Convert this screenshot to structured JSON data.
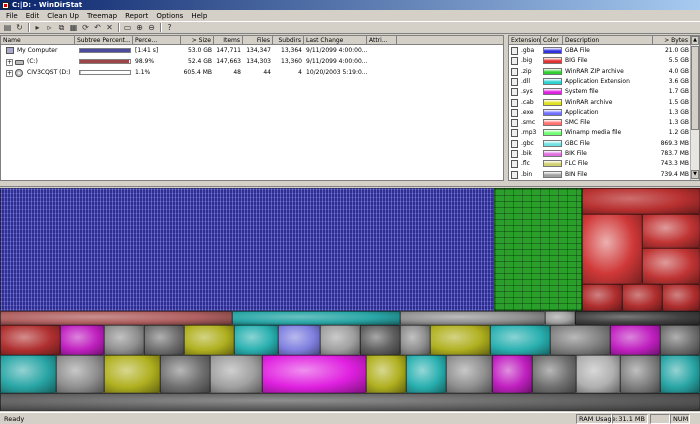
{
  "window": {
    "title": "C:|D: - WinDirStat"
  },
  "menu": [
    "File",
    "Edit",
    "Clean Up",
    "Treemap",
    "Report",
    "Options",
    "Help"
  ],
  "toolbar": [
    "open-folder-icon",
    "refresh-icon",
    "separator",
    "play-icon",
    "step-icon",
    "copy-icon",
    "props-icon",
    "refresh-all-icon",
    "undo-icon",
    "delete-icon",
    "separator",
    "select-icon",
    "zoom-in-icon",
    "zoom-out-icon",
    "separator",
    "help-icon"
  ],
  "dir_columns": [
    "Name",
    "Subtree Percent...",
    "Perce...",
    "> Size",
    "Items",
    "Files",
    "Subdirs",
    "Last Change",
    "Attri..."
  ],
  "dir_rows": [
    {
      "expander": "",
      "icon": "computer-icon",
      "name": "My Computer",
      "bar_pct": 1.0,
      "bar_color": "#4b4ba0",
      "pct": "[1:41 s]",
      "size": "53.0 GB",
      "items": "147,711",
      "files": "134,347",
      "subdirs": "13,364",
      "last_change": "9/11/2099  4:00:00...",
      "attr": ""
    },
    {
      "expander": "+",
      "icon": "drive-icon",
      "name": "(C:)",
      "bar_pct": 0.989,
      "bar_color": "#a04545",
      "pct": "98.9%",
      "size": "52.4 GB",
      "items": "147,663",
      "files": "134,303",
      "subdirs": "13,360",
      "last_change": "9/11/2099  4:00:00...",
      "attr": ""
    },
    {
      "expander": "+",
      "icon": "cd-icon",
      "name": "CIV3CQST (D:)",
      "bar_pct": 0.011,
      "bar_color": "#c0c0c0",
      "pct": "1.1%",
      "size": "605.4 MB",
      "items": "48",
      "files": "44",
      "subdirs": "4",
      "last_change": "10/20/2003  5:19:0...",
      "attr": ""
    }
  ],
  "ext_columns": [
    "Extension",
    "Color",
    "Description",
    "> Bytes"
  ],
  "ext_rows": [
    {
      "ext": ".gba",
      "color": "#3030e0",
      "desc": "GBA File",
      "bytes": "21.0 GB"
    },
    {
      "ext": ".big",
      "color": "#e03030",
      "desc": "BIG File",
      "bytes": "5.5 GB"
    },
    {
      "ext": ".zip",
      "color": "#30d030",
      "desc": "WinRAR ZIP archive",
      "bytes": "4.0 GB"
    },
    {
      "ext": ".dll",
      "color": "#30d0d0",
      "desc": "Application Extension",
      "bytes": "3.6 GB"
    },
    {
      "ext": ".sys",
      "color": "#e020e0",
      "desc": "System file",
      "bytes": "1.7 GB"
    },
    {
      "ext": ".cab",
      "color": "#e0e020",
      "desc": "WinRAR archive",
      "bytes": "1.5 GB"
    },
    {
      "ext": ".exe",
      "color": "#7070ff",
      "desc": "Application",
      "bytes": "1.3 GB"
    },
    {
      "ext": ".smc",
      "color": "#ff7070",
      "desc": "SMC File",
      "bytes": "1.3 GB"
    },
    {
      "ext": ".mp3",
      "color": "#70ff70",
      "desc": "Winamp media file",
      "bytes": "1.2 GB"
    },
    {
      "ext": ".gbc",
      "color": "#70e0e0",
      "desc": "GBC File",
      "bytes": "869.3 MB"
    },
    {
      "ext": ".bik",
      "color": "#e070e0",
      "desc": "BIK File",
      "bytes": "783.7 MB"
    },
    {
      "ext": ".flc",
      "color": "#d0d070",
      "desc": "FLC File",
      "bytes": "743.3 MB"
    },
    {
      "ext": ".bin",
      "color": "#a0a0a0",
      "desc": "BIN File",
      "bytes": "739.4 MB"
    }
  ],
  "status": {
    "ready": "Ready",
    "ram_label": "RAM Usage:",
    "ram_value": "31.1 MB",
    "num": "NUM"
  }
}
